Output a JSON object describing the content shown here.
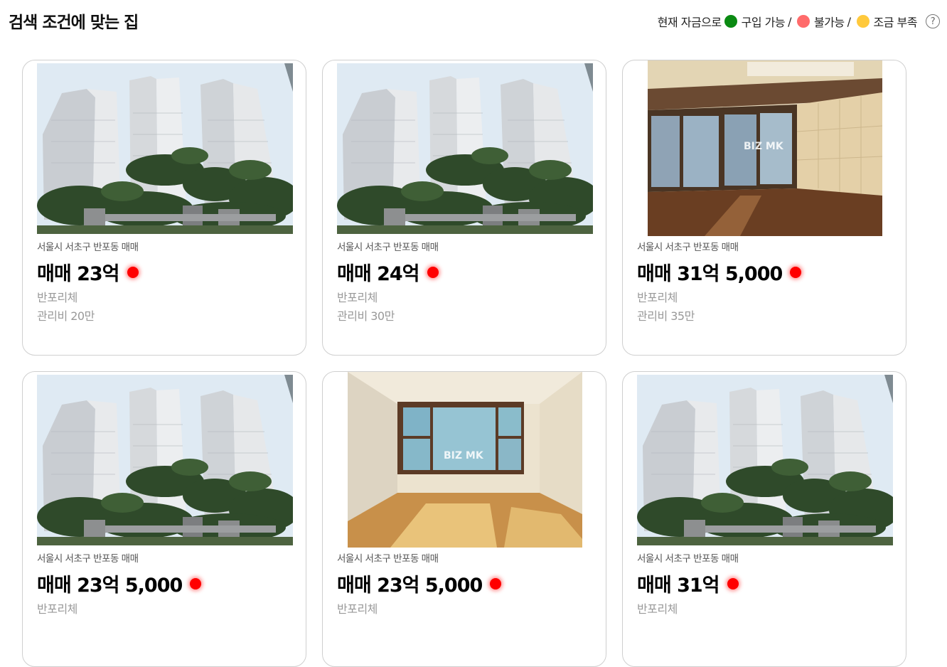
{
  "header": {
    "title": "검색 조건에 맞는 집",
    "legend": {
      "prefix": "현재 자금으로",
      "items": [
        {
          "label": "구입 가능",
          "color": "#0a8a12",
          "separator": "/"
        },
        {
          "label": "불가능",
          "color": "#ff6b6b",
          "separator": "/"
        },
        {
          "label": "조금 부족",
          "color": "#ffc93c",
          "separator": ""
        }
      ],
      "help_icon": "question-circle-icon",
      "help_symbol": "?"
    }
  },
  "listings": [
    {
      "location": "서울시 서초구 반포동 매매",
      "price": "매매 23억",
      "status_color": "#ff0000",
      "complex": "반포리체",
      "fee": "관리비 20만",
      "photo": "apartment-exterior"
    },
    {
      "location": "서울시 서초구 반포동 매매",
      "price": "매매 24억",
      "status_color": "#ff0000",
      "complex": "반포리체",
      "fee": "관리비 30만",
      "photo": "apartment-exterior"
    },
    {
      "location": "서울시 서초구 반포동 매매",
      "price": "매매 31억 5,000",
      "status_color": "#ff0000",
      "complex": "반포리체",
      "fee": "관리비 35만",
      "photo": "living-room-interior",
      "watermark": "BIZ MK"
    },
    {
      "location": "서울시 서초구 반포동 매매",
      "price": "매매 23억 5,000",
      "status_color": "#ff0000",
      "complex": "반포리체",
      "fee": "",
      "photo": "apartment-exterior"
    },
    {
      "location": "서울시 서초구 반포동 매매",
      "price": "매매 23억 5,000",
      "status_color": "#ff0000",
      "complex": "반포리체",
      "fee": "",
      "photo": "room-interior",
      "watermark": "BIZ MK"
    },
    {
      "location": "서울시 서초구 반포동 매매",
      "price": "매매 31억",
      "status_color": "#ff0000",
      "complex": "반포리체",
      "fee": "",
      "photo": "apartment-exterior"
    }
  ]
}
